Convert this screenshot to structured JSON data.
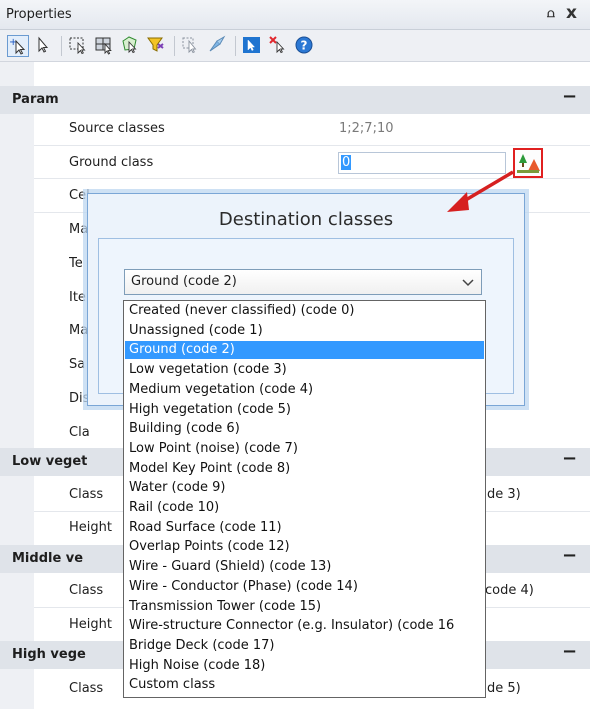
{
  "panel": {
    "title": "Properties",
    "pin_label": "⩍",
    "close_label": "x"
  },
  "toolbar": {
    "buttons": [
      {
        "name": "add-selection-icon"
      },
      {
        "name": "select-pointer-icon"
      },
      {
        "name": "select-rectangle-icon"
      },
      {
        "name": "select-grid-icon"
      },
      {
        "name": "select-polygon-icon"
      },
      {
        "name": "filter-icon"
      },
      {
        "name": "select-points-icon"
      },
      {
        "name": "select-brush-icon"
      },
      {
        "name": "pointer-blue-icon"
      },
      {
        "name": "remove-selection-icon"
      },
      {
        "name": "help-icon"
      }
    ]
  },
  "param": {
    "header": "Param",
    "rows": [
      {
        "label": "Source classes",
        "value": "1;2;7;10"
      },
      {
        "label": "Ground class",
        "value": "0"
      },
      {
        "label": "Cel",
        "value": ""
      },
      {
        "label": "Ma",
        "value": ""
      },
      {
        "label": "Te",
        "value": ""
      },
      {
        "label": "Ite",
        "value": ""
      },
      {
        "label": "Ma",
        "value": ""
      },
      {
        "label": "Sa",
        "value": ""
      },
      {
        "label": "Dis",
        "value": ""
      },
      {
        "label": "Cla",
        "value": ""
      }
    ]
  },
  "low_veg": {
    "header": "Low veget",
    "rows": [
      {
        "label": "Class",
        "value": "de 3)"
      },
      {
        "label": "Height",
        "value": ""
      }
    ]
  },
  "middle_veg": {
    "header": "Middle ve",
    "rows": [
      {
        "label": "Class",
        "value": "code 4)"
      },
      {
        "label": "Height",
        "value": ""
      }
    ]
  },
  "high_veg": {
    "header": "High vege",
    "rows": [
      {
        "label": "Class",
        "value": "de 5)"
      }
    ]
  },
  "collapse_label": "−",
  "dialog": {
    "title": "Destination classes",
    "selected": "Ground (code 2)",
    "selected_index": 2,
    "options": [
      "Created (never classified) (code 0)",
      "Unassigned (code 1)",
      "Ground (code 2)",
      "Low vegetation (code 3)",
      "Medium vegetation (code 4)",
      "High vegetation (code 5)",
      "Building (code 6)",
      "Low Point (noise) (code 7)",
      "Model Key Point (code 8)",
      "Water (code 9)",
      "Rail (code 10)",
      "Road Surface (code 11)",
      "Overlap Points (code 12)",
      "Wire - Guard (Shield) (code 13)",
      "Wire - Conductor (Phase) (code 14)",
      "Transmission Tower (code 15)",
      "Wire-structure Connector (e.g. Insulator) (code 16",
      "Bridge Deck (code 17)",
      "High Noise (code 18)",
      "Custom class"
    ]
  },
  "colors": {
    "accent": "#3399ff",
    "arrow": "#d62020",
    "category_bg": "#dfe3e9"
  }
}
